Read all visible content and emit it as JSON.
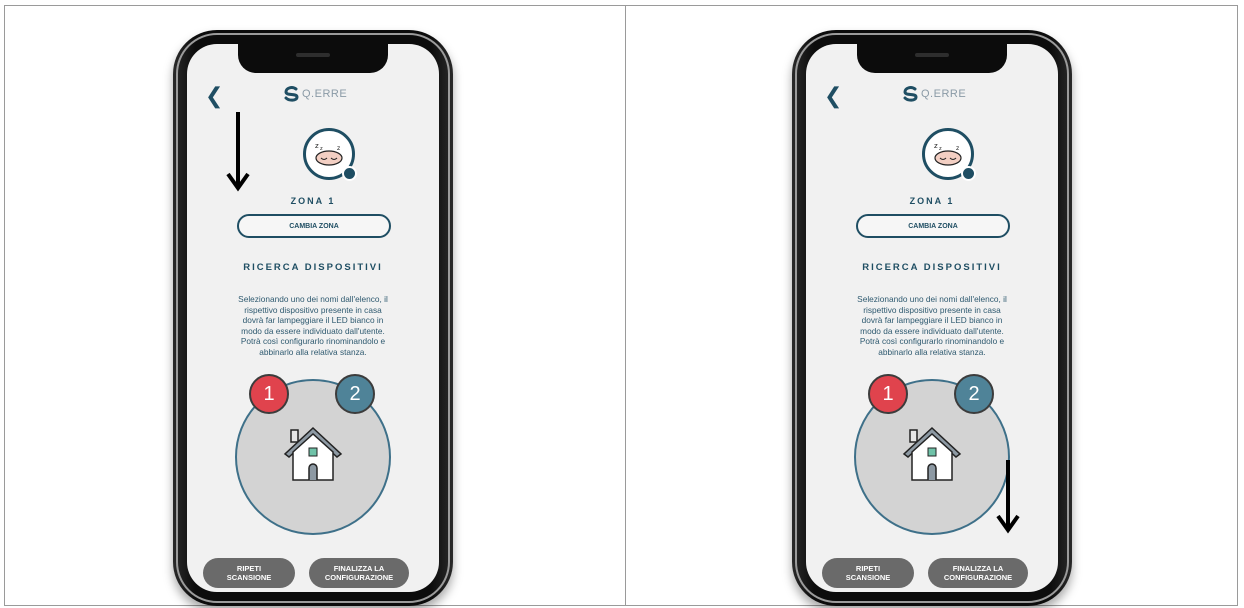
{
  "screens": [
    {
      "header": {
        "back_icon": "chevron-left-icon",
        "logo_text": "Q.ERRE"
      },
      "zone": {
        "label": "ZONA 1",
        "change_button": "CAMBIA ZONA"
      },
      "search": {
        "title": "RICERCA DISPOSITIVI",
        "lines": [
          "Selezionando uno dei nomi dall'elenco, il",
          "rispettivo dispositivo presente in casa",
          "dovrà far lampeggiare il LED bianco in",
          "modo da essere individuato dall'utente.",
          "Potrà così configurarlo rinominandolo  e",
          "abbinarlo alla relativa stanza."
        ]
      },
      "devices": [
        "1",
        "2"
      ],
      "buttons": {
        "repeat_l1": "RIPETI",
        "repeat_l2": "SCANSIONE",
        "final_l1": "FINALIZZA LA",
        "final_l2": "CONFIGURAZIONE"
      }
    },
    {
      "header": {
        "back_icon": "chevron-left-icon",
        "logo_text": "Q.ERRE"
      },
      "zone": {
        "label": "ZONA 1",
        "change_button": "CAMBIA ZONA"
      },
      "search": {
        "title": "RICERCA DISPOSITIVI",
        "lines": [
          "Selezionando uno dei nomi dall'elenco, il",
          "rispettivo dispositivo presente in casa",
          "dovrà far lampeggiare il LED bianco in",
          "modo da essere individuato dall'utente.",
          "Potrà così configurarlo rinominandolo  e",
          "abbinarlo alla relativa stanza."
        ]
      },
      "devices": [
        "1",
        "2"
      ],
      "buttons": {
        "repeat_l1": "RIPETI",
        "repeat_l2": "SCANSIONE",
        "final_l1": "FINALIZZA LA",
        "final_l2": "CONFIGURAZIONE"
      }
    }
  ],
  "colors": {
    "primary": "#1f4e63",
    "device1": "#e0434d",
    "device2": "#4f8398",
    "button_bg": "#6a6a6a"
  }
}
